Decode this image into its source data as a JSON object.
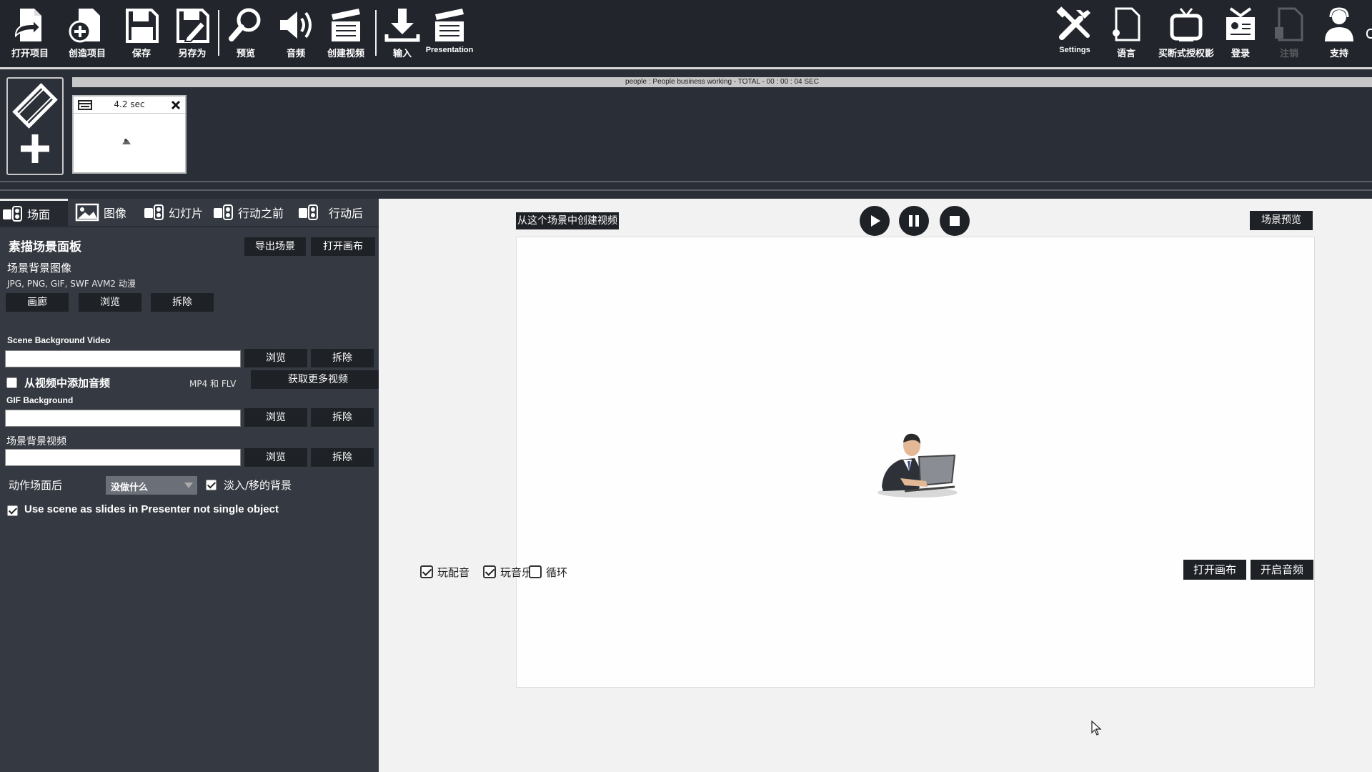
{
  "toolbar": {
    "open_project": "打开项目",
    "create_project": "创造项目",
    "save": "保存",
    "save_as": "另存为",
    "preview": "预览",
    "audio": "音频",
    "create_video": "创建视频",
    "import": "输入",
    "presentation": "Presentation",
    "settings": "Settings",
    "language": "语言",
    "buy_license": "买断式授权影",
    "login": "登录",
    "logout": "注销",
    "support": "支持"
  },
  "timeline": {
    "info": "people : People business working  -  TOTAL -  00 : 00 : 04 SEC",
    "scene_duration": "4.2 sec"
  },
  "tabs": [
    {
      "label": "场面"
    },
    {
      "label": "图像"
    },
    {
      "label": "幻灯片"
    },
    {
      "label": "行动之前"
    },
    {
      "label": "行动后"
    }
  ],
  "panel": {
    "title": "素描场景面板",
    "export_scene": "导出场景",
    "open_canvas": "打开画布",
    "bg_image_label": "场景背景图像",
    "bg_image_formats": "JPG, PNG, GIF, SWF AVM2 动漫",
    "gallery": "画廊",
    "browse": "浏览",
    "remove": "拆除",
    "bg_video_label": "Scene Background Video",
    "bg_video_value": "",
    "add_audio_from_video": "从视频中添加音频",
    "add_audio_checked": false,
    "video_formats": "MP4 和 FLV",
    "get_more_videos": "获取更多视频",
    "gif_bg_label": "GIF Background",
    "gif_bg_value": "",
    "bg_video2_label": "场景背景视频",
    "bg_video2_value": "",
    "after_action_label": "动作场面后",
    "after_action_value": "没做什么",
    "fade_bg_label": "淡入/移的背景",
    "fade_bg_checked": true,
    "use_scene_slides_label": "Use scene as slides in Presenter not single object",
    "use_scene_slides_checked": true
  },
  "preview": {
    "create_video_from_scene": "从这个场景中创建视频",
    "scene_preview": "场景预览",
    "play_voice": "玩配音",
    "play_voice_checked": true,
    "play_music": "玩音乐",
    "play_music_checked": true,
    "loop": "循环",
    "loop_checked": false,
    "open_canvas": "打开画布",
    "enable_audio": "开启音频"
  },
  "colors": {
    "toolbar_bg": "#22262c",
    "panel_bg": "#353941",
    "button_dark": "#1e2126",
    "canvas_bg": "#fefefe"
  }
}
